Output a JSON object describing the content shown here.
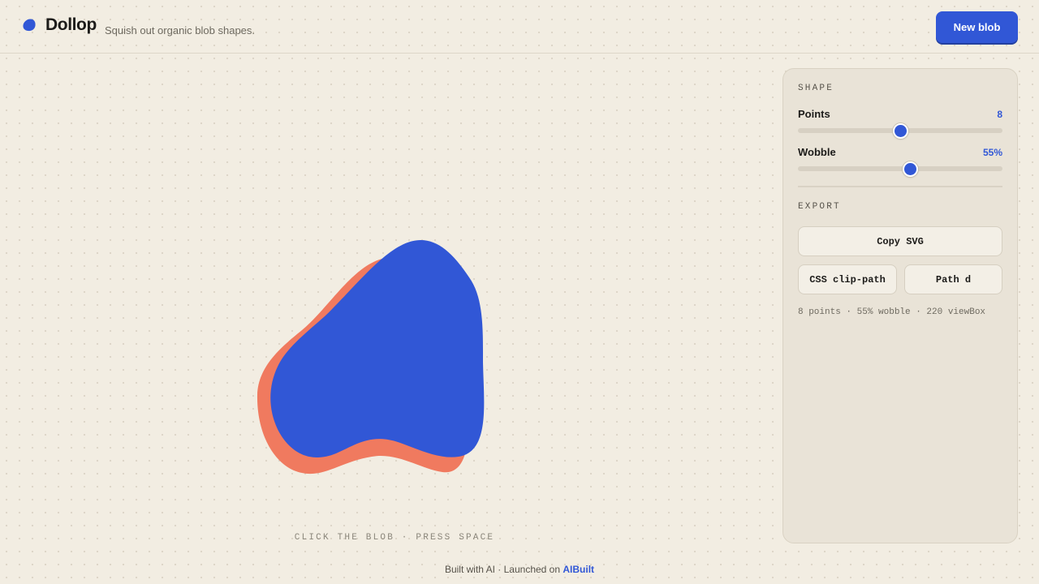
{
  "header": {
    "app_name": "Dollop",
    "tagline": "Squish out organic blob shapes.",
    "new_blob_label": "New blob"
  },
  "canvas": {
    "hint": "CLICK THE BLOB · PRESS SPACE",
    "blob_color": "#3157d6",
    "shadow_color": "#f07a5f"
  },
  "panel": {
    "shape_title": "SHAPE",
    "controls": [
      {
        "label": "Points",
        "value_text": "8",
        "value": 8,
        "min": 3,
        "max": 13
      },
      {
        "label": "Wobble",
        "value_text": "55%",
        "value": 55,
        "min": 0,
        "max": 100
      }
    ],
    "export_title": "EXPORT",
    "copy_svg_label": "Copy SVG",
    "css_clip_path_label": "CSS clip-path",
    "path_d_label": "Path d",
    "meta": "8 points · 55% wobble · 220 viewBox"
  },
  "footer": {
    "prefix": "Built with AI · Launched on ",
    "link_text": "AIBuilt"
  },
  "colors": {
    "accent": "#3157d6",
    "background": "#f2ede2",
    "panel": "#e9e3d7"
  }
}
